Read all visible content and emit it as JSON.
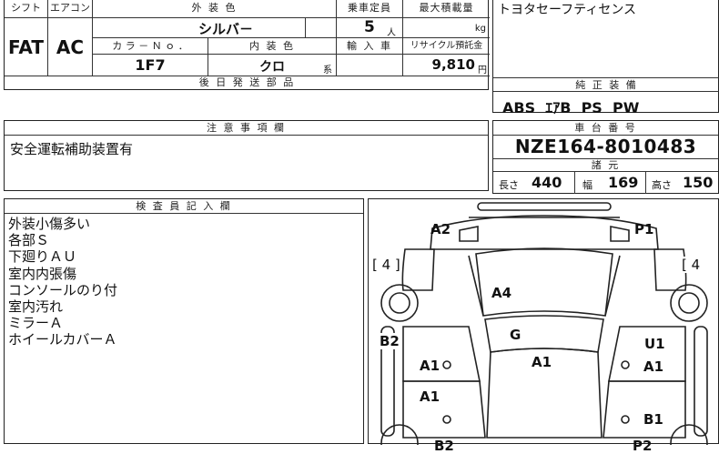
{
  "top_table": {
    "shift_label": "シフト",
    "aircon_label": "エアコン",
    "shift": "FAT",
    "aircon": "AC",
    "exterior_color_label": "外 装 色",
    "exterior_color": "シルバ－",
    "capacity_label": "乗車定員",
    "capacity": "5",
    "capacity_unit": "人",
    "max_load_label": "最大積載量",
    "max_load_unit": "kg",
    "color_no_label": "カ ラ － Ｎ ｏ ．",
    "color_no": "1F7",
    "interior_color_label": "内 装 色",
    "interior_color": "クロ",
    "interior_suffix": "系",
    "import_label": "輸 入 車",
    "recycle_label": "リサイクル預託金",
    "recycle_amount": "9,810",
    "recycle_unit": "円",
    "later_parts_label": "後 日 発 送 部 品"
  },
  "right_top": {
    "notes": "トヨタセーフティセンス",
    "genuine_label": "純 正 装 備",
    "genuine_items": "ABS  ｴｱB  PS  PW"
  },
  "caution": {
    "label": "注 意 事 項 欄",
    "text": "安全運転補助装置有"
  },
  "chassis": {
    "label": "車 台 番 号",
    "number": "NZE164-8010483",
    "specs_label": "諸 元",
    "length_label": "長さ",
    "length": "440",
    "width_label": "幅",
    "width": "169",
    "height_label": "高さ",
    "height": "150"
  },
  "inspector": {
    "label": "検 査 員 記 入 欄",
    "lines": [
      "外装小傷多い",
      "各部Ｓ",
      "下廻りＡＵ",
      "室内内張傷",
      "コンソールのり付",
      "室内汚れ",
      "ミラーＡ",
      "ホイールカバーＡ"
    ]
  },
  "diagram": {
    "marks": {
      "front_left": "A2",
      "front_right": "P1",
      "tire_left": "[ 4 ]",
      "tire_right": "[ 4",
      "roof": "A4",
      "windshield": "G",
      "left_rocker": "B2",
      "right_top": "U1",
      "left_door1": "A1",
      "center": "A1",
      "right_door1": "A1",
      "left_door2": "A1",
      "right_door2": "B1",
      "bottom_left": "B2",
      "bottom_right": "P2"
    }
  }
}
